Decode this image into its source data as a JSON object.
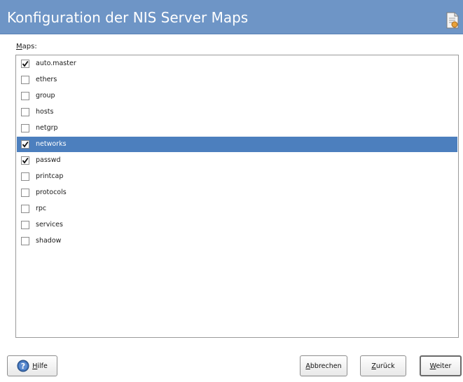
{
  "header": {
    "title": "Konfiguration der NIS Server Maps",
    "icon": "config-document-icon",
    "background": "#6e95c6"
  },
  "maps": {
    "label_mnemonic": "M",
    "label_rest": "aps:",
    "items": [
      {
        "name": "auto.master",
        "checked": true,
        "selected": false
      },
      {
        "name": "ethers",
        "checked": false,
        "selected": false
      },
      {
        "name": "group",
        "checked": false,
        "selected": false
      },
      {
        "name": "hosts",
        "checked": false,
        "selected": false
      },
      {
        "name": "netgrp",
        "checked": false,
        "selected": false
      },
      {
        "name": "networks",
        "checked": true,
        "selected": true
      },
      {
        "name": "passwd",
        "checked": true,
        "selected": false
      },
      {
        "name": "printcap",
        "checked": false,
        "selected": false
      },
      {
        "name": "protocols",
        "checked": false,
        "selected": false
      },
      {
        "name": "rpc",
        "checked": false,
        "selected": false
      },
      {
        "name": "services",
        "checked": false,
        "selected": false
      },
      {
        "name": "shadow",
        "checked": false,
        "selected": false
      }
    ],
    "selection_color": "#4c7fbe"
  },
  "buttons": {
    "help": {
      "mnemonic": "H",
      "rest": "ilfe",
      "icon": "help-icon"
    },
    "cancel": {
      "mnemonic": "A",
      "rest": "bbrechen"
    },
    "back": {
      "mnemonic": "Z",
      "rest": "urück"
    },
    "next": {
      "mnemonic": "W",
      "rest": "eiter"
    }
  }
}
